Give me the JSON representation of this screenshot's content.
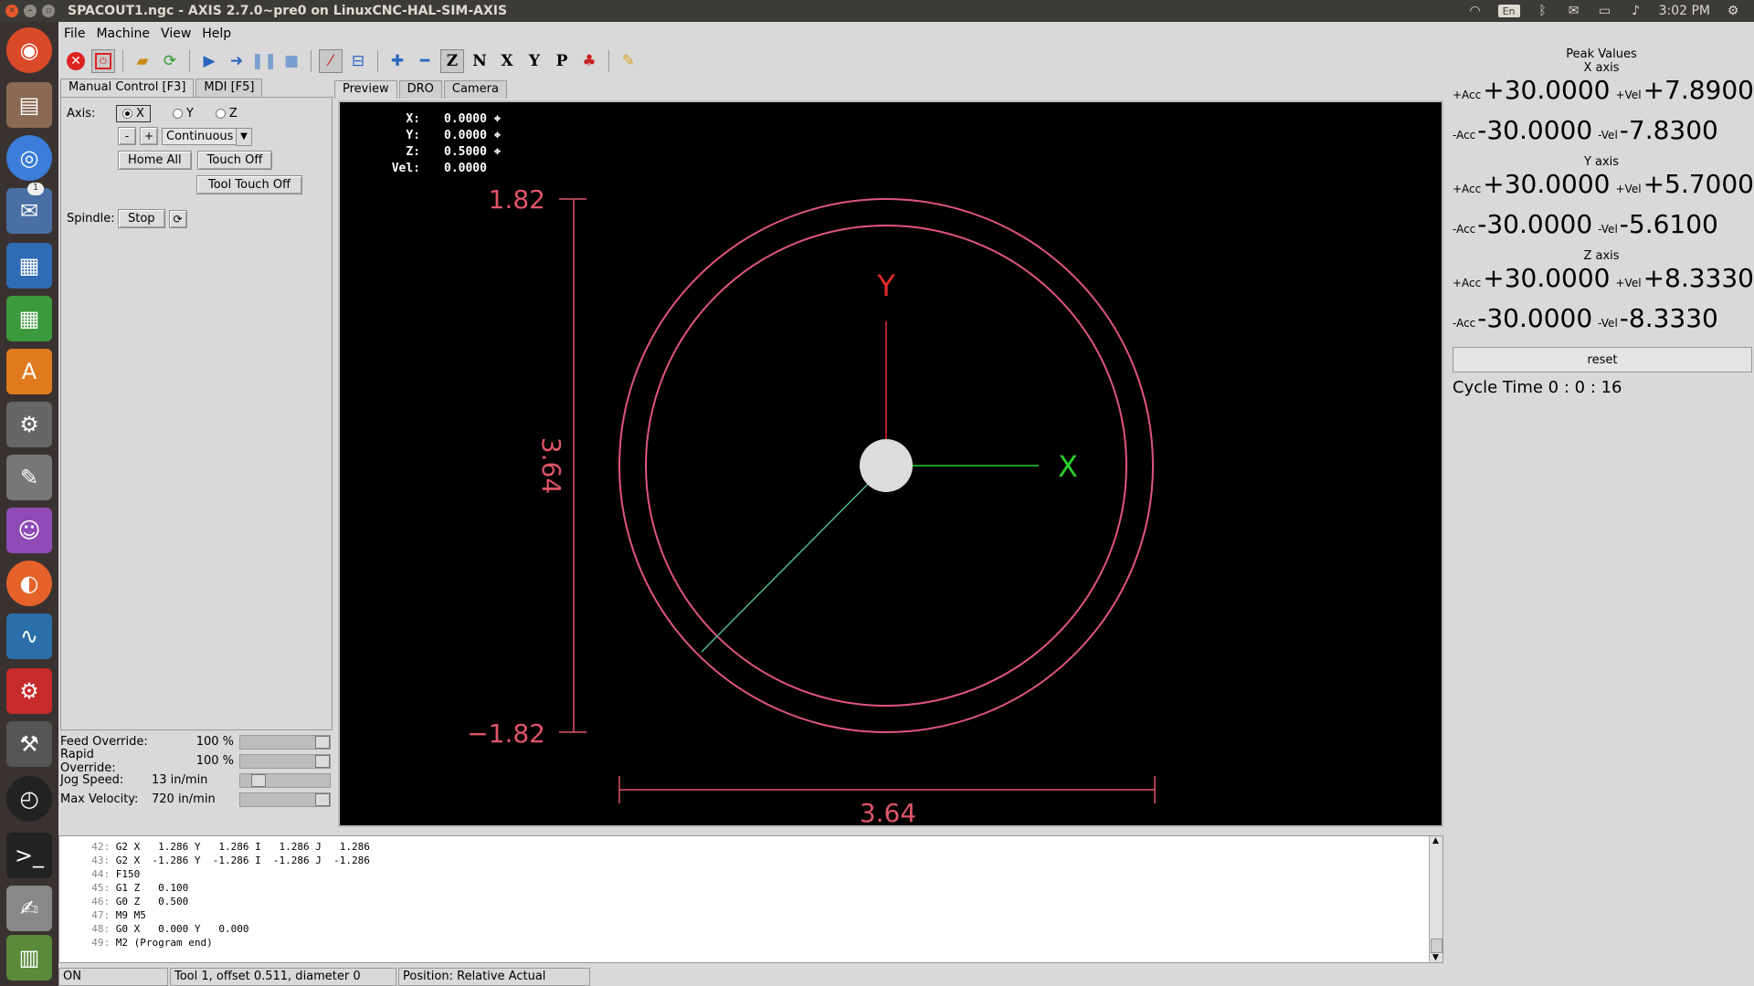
{
  "window": {
    "title": "SPACOUT1.ngc - AXIS 2.7.0~pre0 on LinuxCNC-HAL-SIM-AXIS",
    "tray": {
      "lang": "En",
      "time": "3:02 PM"
    }
  },
  "launcher": {
    "badge": "1"
  },
  "menu": {
    "file": "File",
    "machine": "Machine",
    "view": "View",
    "help": "Help"
  },
  "tabs": {
    "manual": "Manual Control [F3]",
    "mdi": "MDI [F5]"
  },
  "manual": {
    "axis_label": "Axis:",
    "axis_x": "X",
    "axis_y": "Y",
    "axis_z": "Z",
    "jog_minus": "-",
    "jog_plus": "+",
    "jog_mode": "Continuous",
    "home_all": "Home All",
    "touch_off": "Touch Off",
    "tool_touch_off": "Tool Touch Off",
    "spindle_label": "Spindle:",
    "spindle_stop": "Stop"
  },
  "sliders": {
    "feed_label": "Feed Override:",
    "feed_value": "100 %",
    "feed_fraction": 1.0,
    "rapid_label": "Rapid Override:",
    "rapid_value": "100 %",
    "rapid_fraction": 1.0,
    "jog_label": "Jog Speed:",
    "jog_value": "13 in/min",
    "maxvel_label": "Max Velocity:",
    "maxvel_value": "720 in/min"
  },
  "preview_tabs": {
    "preview": "Preview",
    "dro": "DRO",
    "camera": "Camera"
  },
  "dro": {
    "x_label": "X:",
    "x_value": "0.0000",
    "y_label": "Y:",
    "y_value": "0.0000",
    "z_label": "Z:",
    "z_value": "0.5000",
    "vel_label": "Vel:",
    "vel_value": "0.0000"
  },
  "plot": {
    "y_top": "1.82",
    "y_bottom": "−1.82",
    "y_extent": "3.64",
    "x_extent": "3.64",
    "axis_y": "Y",
    "axis_x": "X"
  },
  "code": [
    {
      "n": "42:",
      "t": "G2 X   1.286 Y   1.286 I   1.286 J   1.286"
    },
    {
      "n": "43:",
      "t": "G2 X  -1.286 Y  -1.286 I  -1.286 J  -1.286"
    },
    {
      "n": "44:",
      "t": "F150"
    },
    {
      "n": "45:",
      "t": "G1 Z   0.100"
    },
    {
      "n": "46:",
      "t": "G0 Z   0.500"
    },
    {
      "n": "47:",
      "t": "M9 M5"
    },
    {
      "n": "48:",
      "t": "G0 X   0.000 Y   0.000"
    },
    {
      "n": "49:",
      "t": "M2 (Program end)"
    }
  ],
  "status": {
    "state": "ON",
    "tool": "Tool 1, offset 0.511, diameter 0",
    "position": "Position: Relative Actual"
  },
  "peak": {
    "title": "Peak Values",
    "x_title": "X axis",
    "y_title": "Y axis",
    "z_title": "Z axis",
    "acc_plus_label": "+Acc",
    "acc_minus_label": "-Acc",
    "vel_plus_label": "+Vel",
    "vel_minus_label": "-Vel",
    "x_acc_plus": "+30.0000",
    "x_vel_plus": "+7.8900",
    "x_acc_minus": "-30.0000",
    "x_vel_minus": "-7.8300",
    "y_acc_plus": "+30.0000",
    "y_vel_plus": "+5.7000",
    "y_acc_minus": "-30.0000",
    "y_vel_minus": "-5.6100",
    "z_acc_plus": "+30.0000",
    "z_vel_plus": "+8.3330",
    "z_acc_minus": "-30.0000",
    "z_vel_minus": "-8.3330",
    "reset": "reset",
    "cycle_time": "Cycle Time  0 :  0 : 16"
  }
}
